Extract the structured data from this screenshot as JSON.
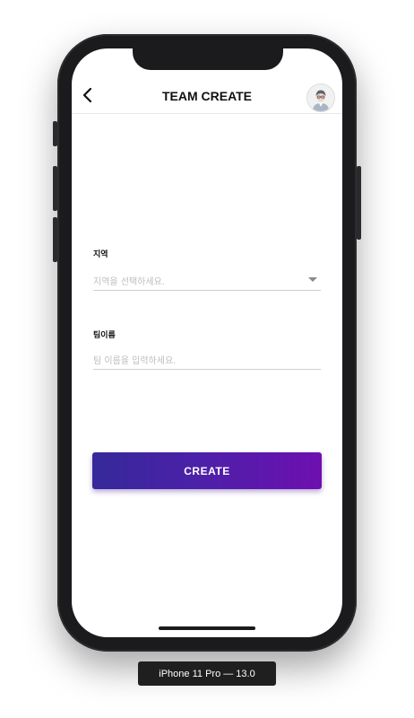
{
  "header": {
    "title": "TEAM CREATE",
    "back_icon": "chevron-left-icon",
    "avatar_icon": "user-avatar-icon"
  },
  "form": {
    "region": {
      "label": "지역",
      "placeholder": "지역을 선택하세요.",
      "dropdown_icon": "caret-down-icon"
    },
    "team_name": {
      "label": "팀이름",
      "placeholder": "팀 이름을 입력하세요."
    }
  },
  "actions": {
    "create_label": "CREATE"
  },
  "device": {
    "label": "iPhone 11 Pro — 13.0"
  },
  "colors": {
    "button_gradient_start": "#35299a",
    "button_gradient_end": "#6e0fb0",
    "title_text": "#111111",
    "placeholder_text": "#bdbdbd"
  }
}
